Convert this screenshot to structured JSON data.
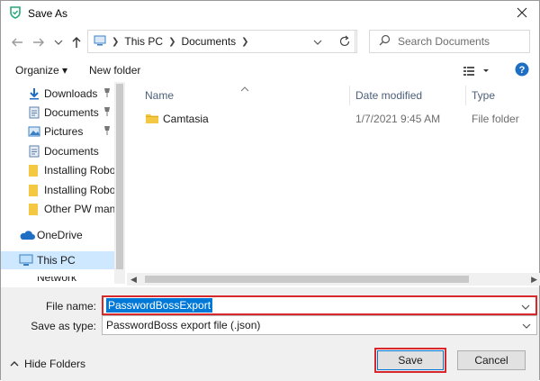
{
  "window": {
    "title": "Save As",
    "close_icon": "close-icon"
  },
  "nav": {
    "back_icon": "back-arrow-icon",
    "forward_icon": "forward-arrow-icon",
    "recent_icon": "chevron-down-icon",
    "up_icon": "up-arrow-icon",
    "breadcrumb": [
      "This PC",
      "Documents"
    ],
    "refresh_icon": "refresh-icon",
    "search_placeholder": "Search Documents"
  },
  "toolbar": {
    "organize": "Organize ▾",
    "new_folder": "New folder",
    "view_icon": "view-options-icon",
    "help_icon": "help-icon"
  },
  "sidebar": {
    "items": [
      {
        "label": "Downloads",
        "icon": "download-icon",
        "pinned": true
      },
      {
        "label": "Documents",
        "icon": "documents-icon",
        "pinned": true
      },
      {
        "label": "Pictures",
        "icon": "pictures-icon",
        "pinned": true
      },
      {
        "label": "Documents",
        "icon": "documents-icon",
        "pinned": false
      },
      {
        "label": "Installing RoboF",
        "icon": "folder-icon",
        "pinned": false
      },
      {
        "label": "Installing RoboF",
        "icon": "folder-icon",
        "pinned": false
      },
      {
        "label": "Other PW mana",
        "icon": "folder-icon",
        "pinned": false
      },
      {
        "label": "OneDrive",
        "icon": "cloud-icon",
        "pinned": false
      },
      {
        "label": "This PC",
        "icon": "computer-icon",
        "pinned": false,
        "selected": true
      },
      {
        "label": "Network",
        "icon": "network-icon",
        "pinned": false
      }
    ]
  },
  "files": {
    "columns": [
      "Name",
      "Date modified",
      "Type"
    ],
    "rows": [
      {
        "name": "Camtasia",
        "date": "1/7/2021 9:45 AM",
        "type": "File folder"
      }
    ]
  },
  "save": {
    "filename_label": "File name:",
    "filename_value": "PasswordBossExport",
    "type_label": "Save as type:",
    "type_value": "PasswordBoss export file (.json)"
  },
  "bottom": {
    "hide_folders": "Hide Folders",
    "save": "Save",
    "cancel": "Cancel"
  },
  "colors": {
    "accent": "#0078d7",
    "highlight": "#d8282b",
    "selected_bg": "#cde8ff",
    "folder": "#f4c842"
  }
}
